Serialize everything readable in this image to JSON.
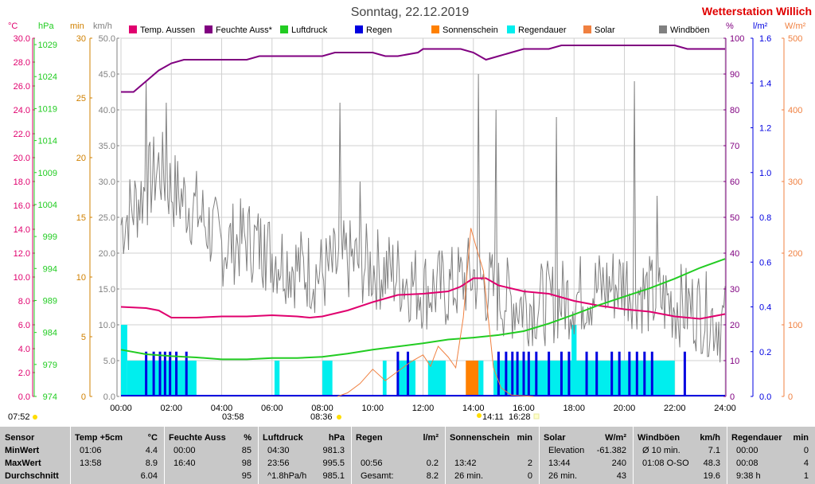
{
  "header": {
    "title": "Sonntag, 22.12.2019",
    "station": "Wetterstation Willich"
  },
  "units": {
    "celsius": "°C",
    "hpa": "hPa",
    "min": "min",
    "kmh": "km/h",
    "percent": "%",
    "lm2": "l/m²",
    "wm2": "W/m²"
  },
  "legend": [
    {
      "label": "Temp. Aussen",
      "color": "#e0006e"
    },
    {
      "label": "Feuchte Auss*",
      "color": "#800080"
    },
    {
      "label": "Luftdruck",
      "color": "#22cc22"
    },
    {
      "label": "Regen",
      "color": "#0000e0"
    },
    {
      "label": "Sonnenschein",
      "color": "#ff8000"
    },
    {
      "label": "Regendauer",
      "color": "#00eeee"
    },
    {
      "label": "Solar",
      "color": "#f08040"
    },
    {
      "label": "Windböen",
      "color": "#808080"
    }
  ],
  "markers": {
    "left_time": "07:52",
    "sunrise": "08:36",
    "moonset": "03:58",
    "sun_peak": "14:11",
    "sunset": "16:28"
  },
  "chart_data": {
    "type": "line",
    "x_ticks": [
      "00:00",
      "02:00",
      "04:00",
      "06:00",
      "08:00",
      "10:00",
      "12:00",
      "14:00",
      "16:00",
      "18:00",
      "20:00",
      "22:00",
      "24:00"
    ],
    "axes": {
      "temp_c": {
        "ticks": [
          "0.0",
          "2.0",
          "4.0",
          "6.0",
          "8.0",
          "10.0",
          "12.0",
          "14.0",
          "16.0",
          "18.0",
          "20.0",
          "22.0",
          "24.0",
          "26.0",
          "28.0",
          "30.0"
        ],
        "range": [
          0,
          30
        ],
        "color": "#e0006e"
      },
      "pressure_hpa": {
        "ticks": [
          "974",
          "979",
          "984",
          "989",
          "994",
          "999",
          "1004",
          "1009",
          "1014",
          "1019",
          "1024",
          "1029"
        ],
        "range": [
          974,
          1030
        ],
        "color": "#22cc22"
      },
      "duration_min": {
        "ticks": [
          "0",
          "5",
          "10",
          "15",
          "20",
          "25",
          "30"
        ],
        "range": [
          0,
          30
        ],
        "color": "#d08000"
      },
      "wind_kmh": {
        "ticks": [
          "0.0",
          "5.0",
          "10.0",
          "15.0",
          "20.0",
          "25.0",
          "30.0",
          "35.0",
          "40.0",
          "45.0",
          "50.0"
        ],
        "range": [
          0,
          50
        ],
        "color": "#808080"
      },
      "humidity_pct": {
        "ticks": [
          "0",
          "10",
          "20",
          "30",
          "40",
          "50",
          "60",
          "70",
          "80",
          "90",
          "100"
        ],
        "range": [
          0,
          100
        ],
        "color": "#800080"
      },
      "rain_lm2": {
        "ticks": [
          "0.0",
          "0.2",
          "0.4",
          "0.6",
          "0.8",
          "1.0",
          "1.2",
          "1.4",
          "1.6"
        ],
        "range": [
          0,
          1.6
        ],
        "color": "#0000e0"
      },
      "solar_wm2": {
        "ticks": [
          "0",
          "100",
          "200",
          "300",
          "400",
          "500"
        ],
        "range": [
          0,
          500
        ],
        "color": "#f08040"
      }
    },
    "series": [
      {
        "name": "Temp. Aussen",
        "axis": "temp_c",
        "color": "#e0006e",
        "points": [
          [
            0,
            7.5
          ],
          [
            1,
            7.4
          ],
          [
            1.5,
            7.2
          ],
          [
            2,
            6.6
          ],
          [
            3,
            6.6
          ],
          [
            4,
            6.7
          ],
          [
            5,
            6.7
          ],
          [
            6,
            6.8
          ],
          [
            7,
            6.7
          ],
          [
            7.5,
            6.6
          ],
          [
            8,
            6.7
          ],
          [
            9,
            7.2
          ],
          [
            10,
            7.9
          ],
          [
            11,
            8.5
          ],
          [
            12,
            8.6
          ],
          [
            13,
            8.8
          ],
          [
            13.5,
            9.2
          ],
          [
            14,
            9.9
          ],
          [
            14.5,
            9.9
          ],
          [
            15,
            9.3
          ],
          [
            16,
            8.8
          ],
          [
            17,
            8.6
          ],
          [
            18,
            8.0
          ],
          [
            19,
            7.6
          ],
          [
            20,
            7.3
          ],
          [
            21,
            7.1
          ],
          [
            22,
            6.7
          ],
          [
            23,
            6.5
          ],
          [
            24,
            6.9
          ]
        ]
      },
      {
        "name": "Feuchte Auss*",
        "axis": "humidity_pct",
        "color": "#800080",
        "points": [
          [
            0,
            85
          ],
          [
            0.5,
            85
          ],
          [
            1,
            88
          ],
          [
            1.5,
            91
          ],
          [
            2,
            93
          ],
          [
            2.5,
            94
          ],
          [
            3,
            94
          ],
          [
            5,
            94
          ],
          [
            5.5,
            95
          ],
          [
            8,
            95
          ],
          [
            8.5,
            96
          ],
          [
            10,
            96
          ],
          [
            10.5,
            95
          ],
          [
            11,
            95
          ],
          [
            11.8,
            96
          ],
          [
            12,
            97
          ],
          [
            13.5,
            97
          ],
          [
            14,
            96
          ],
          [
            14.5,
            94
          ],
          [
            15,
            95
          ],
          [
            15.5,
            96
          ],
          [
            16,
            97
          ],
          [
            17,
            97
          ],
          [
            17.5,
            98
          ],
          [
            21,
            98
          ],
          [
            22,
            98
          ],
          [
            22.5,
            97
          ],
          [
            24,
            97
          ]
        ]
      },
      {
        "name": "Luftdruck",
        "axis": "pressure_hpa",
        "color": "#22cc22",
        "points": [
          [
            0,
            981.3
          ],
          [
            1,
            980.6
          ],
          [
            2,
            980.3
          ],
          [
            3,
            980.1
          ],
          [
            4,
            979.8
          ],
          [
            5,
            979.8
          ],
          [
            6,
            980.0
          ],
          [
            7,
            980.0
          ],
          [
            8,
            980.2
          ],
          [
            9,
            980.7
          ],
          [
            10,
            981.3
          ],
          [
            11,
            981.8
          ],
          [
            12,
            982.3
          ],
          [
            13,
            982.9
          ],
          [
            14,
            983.2
          ],
          [
            15,
            983.6
          ],
          [
            16,
            984.2
          ],
          [
            17,
            985.4
          ],
          [
            18,
            986.8
          ],
          [
            19,
            988.3
          ],
          [
            20,
            989.6
          ],
          [
            21,
            990.9
          ],
          [
            22,
            992.4
          ],
          [
            23,
            994.1
          ],
          [
            24,
            995.5
          ]
        ]
      },
      {
        "name": "Solar",
        "axis": "solar_wm2",
        "color": "#f08040",
        "points": [
          [
            8.6,
            0
          ],
          [
            9,
            5
          ],
          [
            9.5,
            18
          ],
          [
            10,
            38
          ],
          [
            10.5,
            22
          ],
          [
            11,
            35
          ],
          [
            11.5,
            48
          ],
          [
            12,
            58
          ],
          [
            12.3,
            42
          ],
          [
            12.6,
            70
          ],
          [
            13,
            55
          ],
          [
            13.3,
            40
          ],
          [
            13.6,
            110
          ],
          [
            13.9,
            235
          ],
          [
            14.1,
            210
          ],
          [
            14.4,
            175
          ],
          [
            14.8,
            40
          ],
          [
            15.1,
            12
          ],
          [
            15.5,
            2
          ],
          [
            16.4,
            0
          ]
        ]
      }
    ],
    "gust_series": {
      "name": "Windböen",
      "axis": "wind_kmh",
      "color": "#808080",
      "control": [
        [
          0,
          24
        ],
        [
          1,
          29
        ],
        [
          1.5,
          32
        ],
        [
          2,
          29
        ],
        [
          3,
          26
        ],
        [
          4,
          21
        ],
        [
          5,
          22
        ],
        [
          6,
          20
        ],
        [
          7,
          18
        ],
        [
          8,
          17
        ],
        [
          9,
          19
        ],
        [
          10,
          18
        ],
        [
          11,
          17
        ],
        [
          12,
          15
        ],
        [
          13,
          15
        ],
        [
          14,
          17
        ],
        [
          15,
          14
        ],
        [
          16,
          13
        ],
        [
          17,
          13
        ],
        [
          18,
          14
        ],
        [
          19,
          15
        ],
        [
          20,
          16
        ],
        [
          21,
          14
        ],
        [
          22,
          13
        ],
        [
          23,
          12
        ],
        [
          24,
          10
        ]
      ],
      "amplitude": 6,
      "spikes": [
        [
          1,
          44
        ],
        [
          1.8,
          41
        ],
        [
          5.7,
          24
        ],
        [
          8.7,
          41
        ],
        [
          9.5,
          30
        ],
        [
          14.2,
          45
        ],
        [
          14.9,
          40
        ],
        [
          17.3,
          39
        ],
        [
          20.4,
          44
        ],
        [
          21.3,
          28
        ]
      ]
    },
    "rain_events_h": [
      1.0,
      1.3,
      1.55,
      1.75,
      1.95,
      2.2,
      2.6,
      11.0,
      11.4,
      15.0,
      15.3,
      15.55,
      15.75,
      16.0,
      16.2,
      16.5,
      17.0,
      17.5,
      17.8,
      18.5,
      18.9,
      19.5,
      19.8,
      20.2,
      20.5,
      20.8,
      21.1,
      22.4
    ],
    "regendauer_blocks": [
      [
        0.0,
        0.25,
        6
      ],
      [
        0.25,
        1.0,
        3
      ],
      [
        1.0,
        3.0,
        3
      ],
      [
        6.1,
        6.3,
        3
      ],
      [
        8.0,
        8.4,
        3
      ],
      [
        10.4,
        10.55,
        3
      ],
      [
        11.0,
        11.7,
        3
      ],
      [
        12.2,
        12.9,
        3
      ],
      [
        14.2,
        14.4,
        3
      ],
      [
        14.8,
        16.0,
        3
      ],
      [
        16.0,
        22.0,
        3
      ],
      [
        17.9,
        18.1,
        6
      ]
    ],
    "sunshine_blocks": [
      [
        13.7,
        14.2,
        3
      ]
    ]
  },
  "stats": {
    "sections": [
      {
        "title": "Sensor",
        "rows": [
          "MinWert",
          "MaxWert",
          "Durchschnitt"
        ]
      },
      {
        "title": "Temp +5cm",
        "unit": "°C",
        "rows": [
          [
            "01:06",
            "4.4"
          ],
          [
            "13:58",
            "8.9"
          ],
          [
            "",
            "6.04"
          ]
        ]
      },
      {
        "title": "Feuchte Auss",
        "unit": "%",
        "rows": [
          [
            "00:00",
            "85"
          ],
          [
            "16:40",
            "98"
          ],
          [
            "",
            "95"
          ]
        ]
      },
      {
        "title": "Luftdruck",
        "unit": "hPa",
        "rows": [
          [
            "04:30",
            "981.3"
          ],
          [
            "23:56",
            "995.5"
          ],
          [
            "^1.8hPa/h",
            "985.1"
          ]
        ]
      },
      {
        "title": "Regen",
        "unit": "l/m²",
        "rows": [
          [
            "",
            ""
          ],
          [
            "00:56",
            "0.2"
          ],
          [
            "Gesamt:",
            "8.2"
          ]
        ]
      },
      {
        "title": "Sonnenschein",
        "unit": "min",
        "rows": [
          [
            "",
            ""
          ],
          [
            "13:42",
            "2"
          ],
          [
            "26 min.",
            "0"
          ]
        ]
      },
      {
        "title": "Solar",
        "unit": "W/m²",
        "rows": [
          [
            "Elevation",
            "-61.382"
          ],
          [
            "13:44",
            "240"
          ],
          [
            "26 min.",
            "43"
          ]
        ]
      },
      {
        "title": "Windböen",
        "unit": "km/h",
        "rows": [
          [
            "Ø 10 min.",
            "7.1"
          ],
          [
            "01:08   O-SO",
            "48.3"
          ],
          [
            "",
            "19.6"
          ]
        ]
      },
      {
        "title": "Regendauer",
        "unit": "min",
        "rows": [
          [
            "00:00",
            "0"
          ],
          [
            "00:08",
            "4"
          ],
          [
            "9:38 h",
            "1"
          ]
        ]
      }
    ]
  }
}
